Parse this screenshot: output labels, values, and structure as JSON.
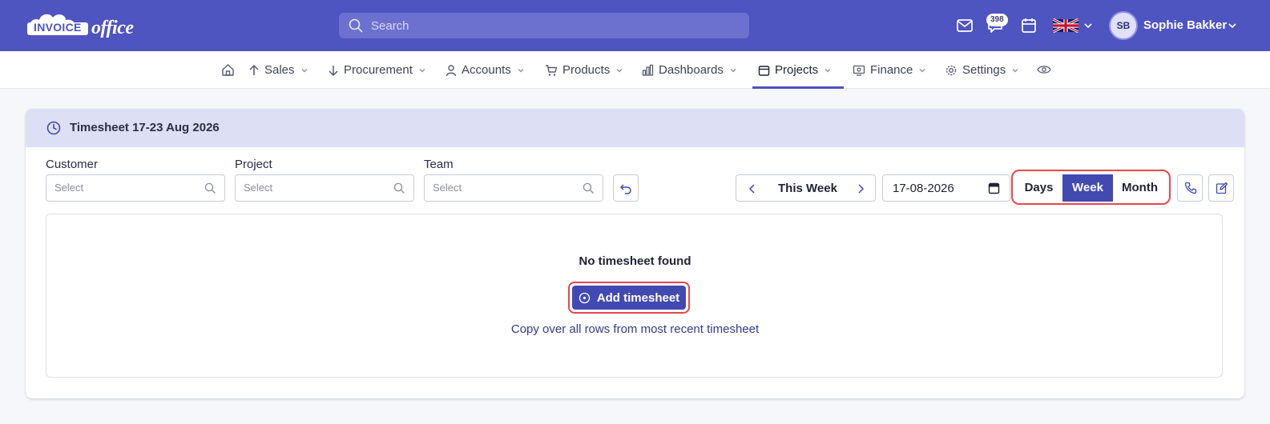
{
  "brand": {
    "logo_part1": "INVOICE",
    "logo_part2": "office"
  },
  "search": {
    "placeholder": "Search"
  },
  "header": {
    "notifications_count": "398",
    "user_initials": "SB",
    "user_name": "Sophie Bakker"
  },
  "nav": {
    "items": [
      {
        "label": "Sales"
      },
      {
        "label": "Procurement"
      },
      {
        "label": "Accounts"
      },
      {
        "label": "Products"
      },
      {
        "label": "Dashboards"
      },
      {
        "label": "Projects"
      },
      {
        "label": "Finance"
      },
      {
        "label": "Settings"
      }
    ],
    "active": "Projects"
  },
  "card": {
    "title": "Timesheet 17-23 Aug 2026"
  },
  "filters": {
    "customer_label": "Customer",
    "project_label": "Project",
    "team_label": "Team",
    "placeholder": "Select"
  },
  "period": {
    "label": "This Week",
    "date": "17-08-2026",
    "views": [
      "Days",
      "Week",
      "Month"
    ],
    "selected_view": "Week"
  },
  "empty_state": {
    "title": "No timesheet found",
    "add_label": "Add timesheet",
    "copy_label": "Copy over all rows from most recent timesheet"
  },
  "colors": {
    "brand": "#4e54c0",
    "accent": "#4249b0",
    "highlight": "#e5484d",
    "header_bg": "#dde0f5"
  }
}
